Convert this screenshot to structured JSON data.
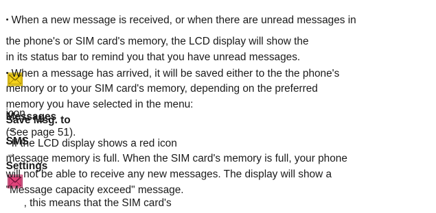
{
  "p1": {
    "bullet": "•",
    "l1": "When a new message is received, or when there are unread messages in",
    "l2a": "the phone's or SIM card's memory, the LCD display will show the",
    "icon": "envelope-icon",
    "icon_color": "#f4d21a",
    "l2b": "icon",
    "l3": "in its status bar to remind you that you have unread messages."
  },
  "p2": {
    "bullet": "•",
    "l1": "When a message has arrived, it will be saved either to the the phone's",
    "l2": "memory or to your SIM card's memory, depending on the preferred",
    "l3a": "memory you have selected in the menu:",
    "m1": "Messages",
    "arrow1": "→",
    "m2": "SMS",
    "arrow2": "→",
    "m3": "Settings",
    "arrow3": "→",
    "m4": "Save Msg. to",
    "l4b": "(See page 51)."
  },
  "p3": {
    "bullet": "•",
    "l1a": "If the LCD display shows a red icon",
    "icon": "envelope-full-icon",
    "icon_color": "#e0447a",
    "l1b": ", this means that the SIM card's",
    "l2": "message memory is full. When the SIM card's memory is full, your phone",
    "l3": "will not be able to receive any new messages. The display will show a",
    "l4": "\"Message capacity exceed\" message."
  }
}
